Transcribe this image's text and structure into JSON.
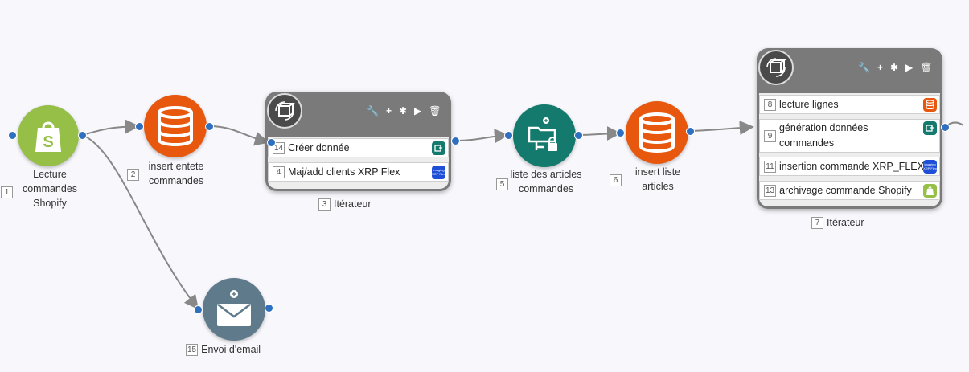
{
  "nodes": {
    "lecture": {
      "num": "1",
      "label_line1": "Lecture",
      "label_line2": "commandes",
      "label_line3": "Shopify",
      "icon": "shopify-bag-icon"
    },
    "insert_entete": {
      "num": "2",
      "label_line1": "insert entete",
      "label_line2": "commandes",
      "icon": "database-icon"
    },
    "iterateur1": {
      "num": "3",
      "label": "Itérateur",
      "rows": [
        {
          "num": "14",
          "label": "Créer donnée",
          "icon": "data-create-icon"
        },
        {
          "num": "4",
          "label": "Maj/add clients XRP Flex",
          "icon": "xrp-flex-icon"
        }
      ]
    },
    "liste_articles": {
      "num": "5",
      "label_line1": "liste des articles",
      "label_line2": "commandes",
      "icon": "folder-network-lock-icon"
    },
    "insert_articles": {
      "num": "6",
      "label_line1": "insert liste",
      "label_line2": "articles",
      "icon": "database-icon"
    },
    "iterateur2": {
      "num": "7",
      "label": "Itérateur",
      "rows": [
        {
          "num": "8",
          "label": "lecture lignes",
          "icon": "database-icon"
        },
        {
          "num": "9",
          "label_line1": "génération données",
          "label_line2": "commandes",
          "icon": "data-create-icon"
        },
        {
          "num": "11",
          "label": "insertion commande XRP_FLEX",
          "icon": "xrp-flex-icon"
        },
        {
          "num": "13",
          "label": "archivage commande Shopify",
          "icon": "shopify-bag-icon"
        }
      ]
    },
    "email": {
      "num": "15",
      "label": "Envoi d'email",
      "icon": "envelope-icon"
    }
  },
  "toolbar_icons": [
    "wrench-icon",
    "plus-icon",
    "puzzle-icon",
    "play-icon",
    "trash-icon"
  ],
  "xrp_logo_text": "Imaging XRP Flex",
  "colors": {
    "shopify": "#95bf47",
    "database": "#e8570e",
    "teal": "#137a6d",
    "email": "#5f7b8b",
    "port": "#2f6fbf",
    "wire": "#888888",
    "iterator_header": "#7a7a7a"
  }
}
